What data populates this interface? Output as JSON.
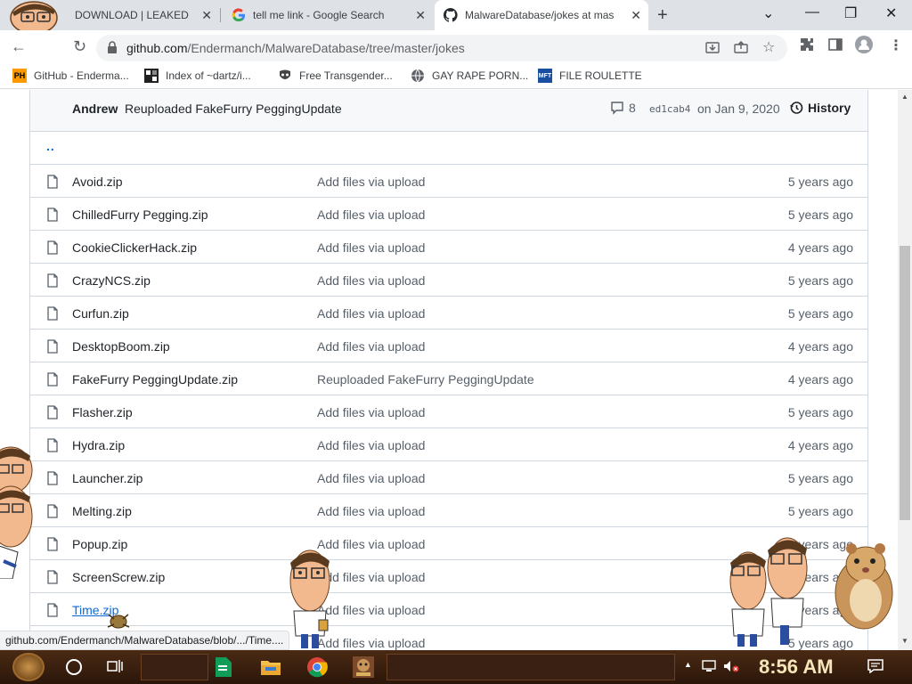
{
  "browser": {
    "tabs": [
      {
        "title": "DOWNLOAD | LEAKED",
        "active": false
      },
      {
        "title": "tell me link - Google Search",
        "active": false
      },
      {
        "title": "MalwareDatabase/jokes at mas",
        "active": true
      }
    ],
    "url_host": "github.com",
    "url_path": "/Endermanch/MalwareDatabase/tree/master/jokes",
    "bookmarks": [
      {
        "label": "GitHub - Enderma...",
        "icon": "PH"
      },
      {
        "label": "Index of ~dartz/i...",
        "icon": "grid-icon"
      },
      {
        "label": "Free Transgender...",
        "icon": "mask-icon"
      },
      {
        "label": "GAY RAPE PORN...",
        "icon": "globe-icon"
      },
      {
        "label": "FILE ROULETTE",
        "icon": "MFT"
      }
    ]
  },
  "repo": {
    "commit": {
      "author": "Andrew",
      "message": "Reuploaded FakeFurry PeggingUpdate",
      "comments": "8",
      "sha": "ed1cab4",
      "date": "on Jan 9, 2020",
      "history_label": "History"
    },
    "parent_dir": "..",
    "files": [
      {
        "name": "Avoid.zip",
        "message": "Add files via upload",
        "age": "5 years ago"
      },
      {
        "name": "ChilledFurry Pegging.zip",
        "message": "Add files via upload",
        "age": "5 years ago"
      },
      {
        "name": "CookieClickerHack.zip",
        "message": "Add files via upload",
        "age": "4 years ago"
      },
      {
        "name": "CrazyNCS.zip",
        "message": "Add files via upload",
        "age": "5 years ago"
      },
      {
        "name": "Curfun.zip",
        "message": "Add files via upload",
        "age": "5 years ago"
      },
      {
        "name": "DesktopBoom.zip",
        "message": "Add files via upload",
        "age": "4 years ago"
      },
      {
        "name": "FakeFurry PeggingUpdate.zip",
        "message": "Reuploaded FakeFurry PeggingUpdate",
        "age": "4 years ago"
      },
      {
        "name": "Flasher.zip",
        "message": "Add files via upload",
        "age": "5 years ago"
      },
      {
        "name": "Hydra.zip",
        "message": "Add files via upload",
        "age": "4 years ago"
      },
      {
        "name": "Launcher.zip",
        "message": "Add files via upload",
        "age": "5 years ago"
      },
      {
        "name": "Melting.zip",
        "message": "Add files via upload",
        "age": "5 years ago"
      },
      {
        "name": "Popup.zip",
        "message": "Add files via upload",
        "age": "5 years ago"
      },
      {
        "name": "ScreenScrew.zip",
        "message": "Add files via upload",
        "age": "5 years ago"
      },
      {
        "name": "Time.zip",
        "message": "Add files via upload",
        "age": "5 years ago"
      },
      {
        "name": "",
        "message": "Add files via upload",
        "age": "5 years ago"
      }
    ]
  },
  "status_url": "github.com/Endermanch/MalwareDatabase/blob/.../Time....",
  "taskbar": {
    "clock": "8:56 AM"
  },
  "colors": {
    "link_blue": "#0969da",
    "border": "#d0d7de",
    "taskbar_brown": "#3a2012"
  }
}
